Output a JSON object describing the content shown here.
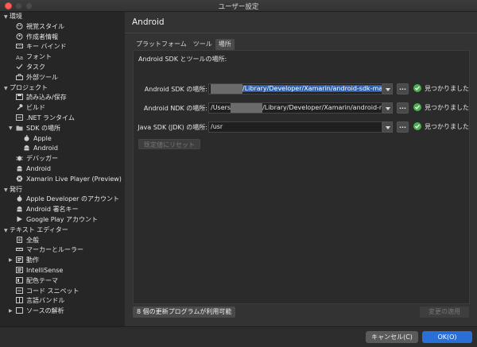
{
  "window": {
    "title": "ユーザー設定"
  },
  "sidebar": {
    "categories": [
      {
        "label": "環境",
        "items": [
          "視覚スタイル",
          "作成者情報",
          "キー バインド",
          "フォント",
          "タスク",
          "外部ツール"
        ]
      },
      {
        "label": "プロジェクト",
        "items": [
          "読み込み/保存",
          "ビルド",
          ".NET ランタイム",
          "SDK の場所",
          "Apple",
          "Android",
          "デバッガー",
          "Android",
          "Xamarin Live Player (Preview)"
        ]
      },
      {
        "label": "発行",
        "items": [
          "Apple Developer のアカウント",
          "Android 署名キー",
          "Google Play アカウント"
        ]
      },
      {
        "label": "テキスト エディター",
        "items": [
          "全般",
          "マーカーとルーラー",
          "動作",
          "IntelliSense",
          "配色テーマ",
          "コード スニペット",
          "言語バンドル",
          "ソースの解析"
        ]
      }
    ]
  },
  "main": {
    "title": "Android",
    "tabs": [
      "プラットフォーム",
      "ツール",
      "場所"
    ],
    "section_label": "Android SDK とツールの場所:",
    "rows": [
      {
        "label": "Android SDK の場所:",
        "value_suffix": "/Library/Developer/Xamarin/android-sdk-macosx",
        "status": "見つかりました"
      },
      {
        "label": "Android NDK の場所:",
        "value_prefix": "/Users",
        "value_suffix": "/Library/Developer/Xamarin/android-ndk",
        "status": "見つかりました"
      },
      {
        "label": "Java SDK (JDK) の場所:",
        "value": "/usr",
        "status": "見つかりました"
      }
    ],
    "browse_label": "...",
    "reset_label": "既定値にリセット",
    "updates_label": "8 個の更新プログラムが利用可能",
    "apply_label": "変更の適用"
  },
  "footer": {
    "cancel_label": "キャンセル(C)",
    "ok_label": "OK(O)"
  },
  "colors": {
    "accent": "#2a6fd6",
    "found": "#4caf50",
    "close": "#fd5f57"
  }
}
